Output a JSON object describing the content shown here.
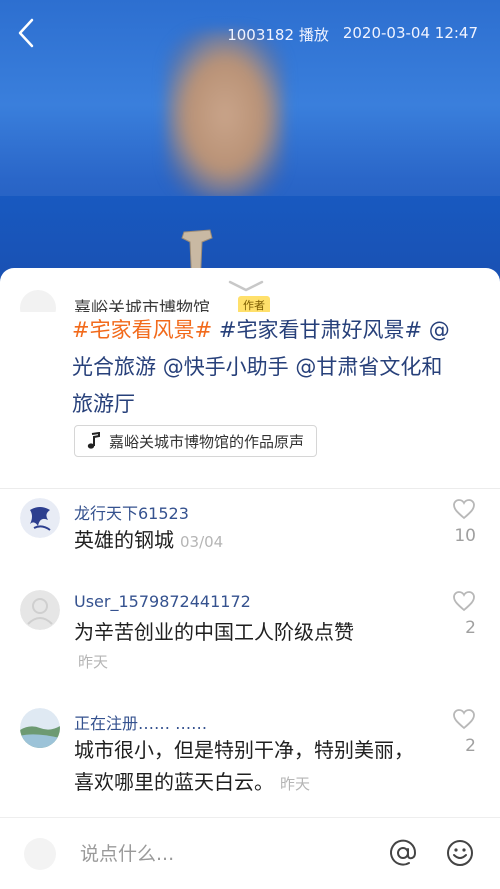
{
  "video": {
    "play_count": "1003182",
    "play_label": "播放",
    "datetime": "2020-03-04 12:47"
  },
  "post": {
    "author_name": "嘉峪关城市博物馆",
    "author_badge": "作者",
    "caption": {
      "hashtag_primary": "#宅家看风景#",
      "hashtag_secondary": "#宅家看甘肃好风景#",
      "mention_1": "@光合旅游",
      "mention_2": "@快手小助手",
      "mention_3": "@甘肃省文化和旅游厅"
    },
    "music_label": "嘉峪关城市博物馆的作品原声"
  },
  "comments": [
    {
      "username": "龙行天下61523",
      "text": "英雄的钢城",
      "time": "03/04",
      "likes": "10"
    },
    {
      "username": "User_1579872441172",
      "text": "为辛苦创业的中国工人阶级点赞",
      "time": "昨天",
      "likes": "2"
    },
    {
      "username": "正在注册…… ……",
      "text": "城市很小，但是特别干净，特别美丽，喜欢哪里的蓝天白云。",
      "time": "昨天",
      "likes": "2"
    }
  ],
  "composer": {
    "placeholder": "说点什么..."
  },
  "icons": {
    "back": "chevron-left-icon",
    "collapse": "chevron-down-icon",
    "music": "music-note-icon",
    "like": "heart-outline-icon",
    "mention": "at-icon",
    "emoji": "smiley-icon"
  },
  "colors": {
    "hashtag_hot": "#f26a1b",
    "link": "#27407a",
    "username": "#35528f"
  }
}
